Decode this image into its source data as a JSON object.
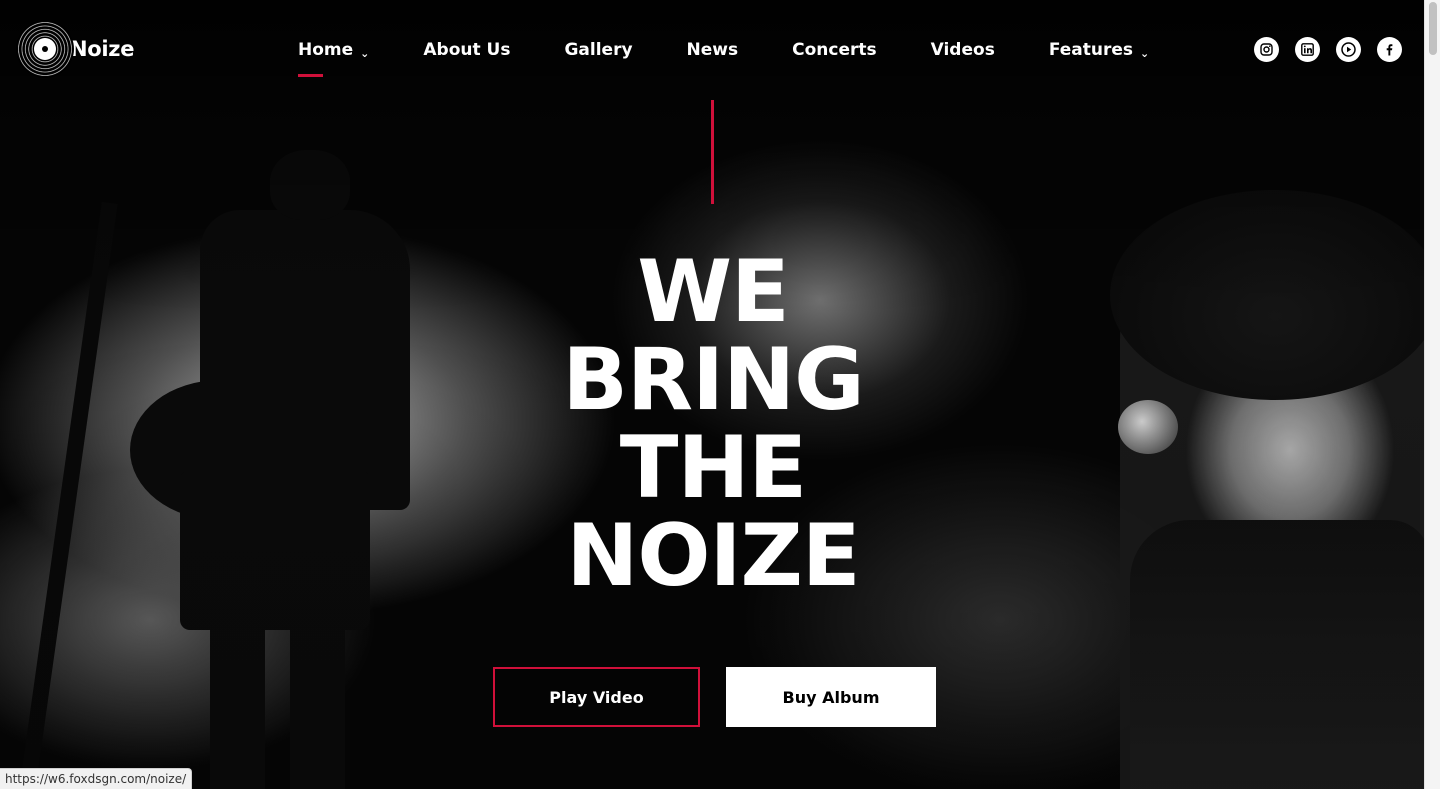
{
  "brand": {
    "name": "Noize",
    "accent_color": "#d0103a"
  },
  "nav": {
    "items": [
      {
        "label": "Home",
        "has_dropdown": true,
        "active": true
      },
      {
        "label": "About Us",
        "has_dropdown": false
      },
      {
        "label": "Gallery",
        "has_dropdown": false
      },
      {
        "label": "News",
        "has_dropdown": false
      },
      {
        "label": "Concerts",
        "has_dropdown": false
      },
      {
        "label": "Videos",
        "has_dropdown": false
      },
      {
        "label": "Features",
        "has_dropdown": true
      }
    ],
    "caret": "⌄"
  },
  "socials": [
    {
      "icon": "instagram-icon"
    },
    {
      "icon": "linkedin-icon"
    },
    {
      "icon": "youtube-icon"
    },
    {
      "icon": "facebook-icon"
    }
  ],
  "hero": {
    "headline_lines": [
      "WE",
      "BRING",
      "THE",
      "NOIZE"
    ],
    "play_button": "Play Video",
    "buy_button": "Buy Album"
  },
  "status_bar": {
    "url": "https://w6.foxdsgn.com/noize/"
  }
}
